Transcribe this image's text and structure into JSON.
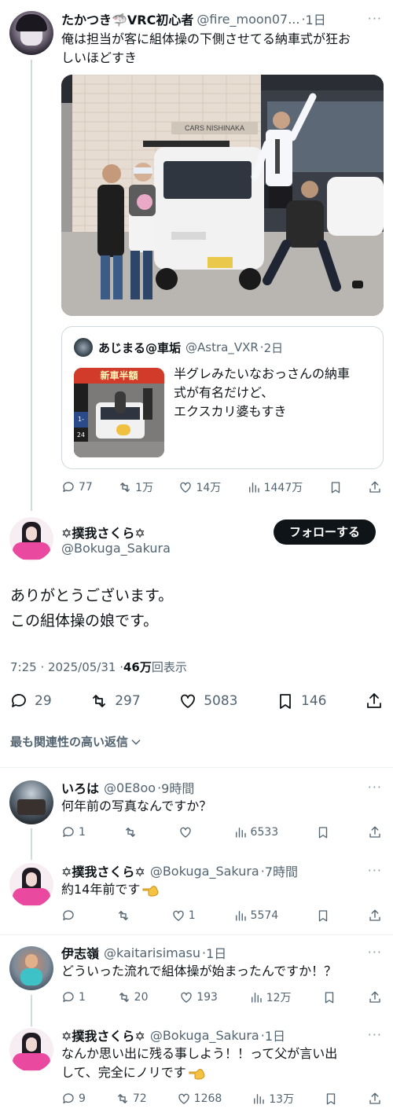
{
  "tweet1": {
    "name": "たかつき🦈VRC初心者",
    "handle": "@fire_moon07...",
    "time": "1日",
    "text_line1": "俺は担当が客に組体操の下側させてる納車式が狂お",
    "text_line2": "しいほどすき",
    "photo_sign": "CARS NISHINAKA",
    "quote": {
      "name": "あじまる@車垢",
      "handle": "@Astra_VXR",
      "time": "2日",
      "text_line1": "半グレみたいなおっさんの納車",
      "text_line2": "式が有名だけど、",
      "text_line3": "エクスカリ婆もすき",
      "thumb_sign": "新車半額",
      "thumb_sign2": "1-24"
    },
    "actions": {
      "reply": "77",
      "retweet": "1万",
      "like": "14万",
      "views": "1447万"
    }
  },
  "main": {
    "name": "✡撲我さくら✡",
    "handle": "@Bokuga_Sakura",
    "follow_label": "フォローする",
    "text_line1": "ありがとうございます。",
    "text_line2": "この組体操の娘です。",
    "meta_time": "7:25 · 2025/05/31 · ",
    "meta_views": "46万",
    "meta_views_suffix": "回表示",
    "actions": {
      "reply": "29",
      "retweet": "297",
      "like": "5083",
      "bookmark": "146"
    }
  },
  "sort_label": "最も関連性の高い返信",
  "replies": [
    {
      "name": "いろは",
      "handle": "@0E8oo",
      "time": "9時間",
      "text": "何年前の写真なんですか？",
      "reply": "1",
      "retweet": "",
      "like": "",
      "views": "6533"
    },
    {
      "name": "✡撲我さくら✡",
      "handle": "@Bokuga_Sakura",
      "time": "7時間",
      "text": "約14年前です",
      "reply": "",
      "retweet": "",
      "like": "1",
      "views": "5574"
    },
    {
      "name": "伊志嶺",
      "handle": "@kaitarisimasu",
      "time": "1日",
      "text": "どういった流れで組体操が始まったんですか！？",
      "reply": "1",
      "retweet": "20",
      "like": "193",
      "views": "12万"
    },
    {
      "name": "✡撲我さくら✡",
      "handle": "@Bokuga_Sakura",
      "time": "1日",
      "text_line1": "なんか思い出に残る事しよう！！って父が言い出",
      "text_line2": "して、完全にノリです",
      "reply": "9",
      "retweet": "72",
      "like": "1268",
      "views": "13万"
    }
  ],
  "more_label": "···",
  "dot_sep": "·",
  "colors": {
    "text": "#0f1419",
    "secondary": "#536471",
    "line": "#cfd9de",
    "divider": "#eff3f4"
  }
}
